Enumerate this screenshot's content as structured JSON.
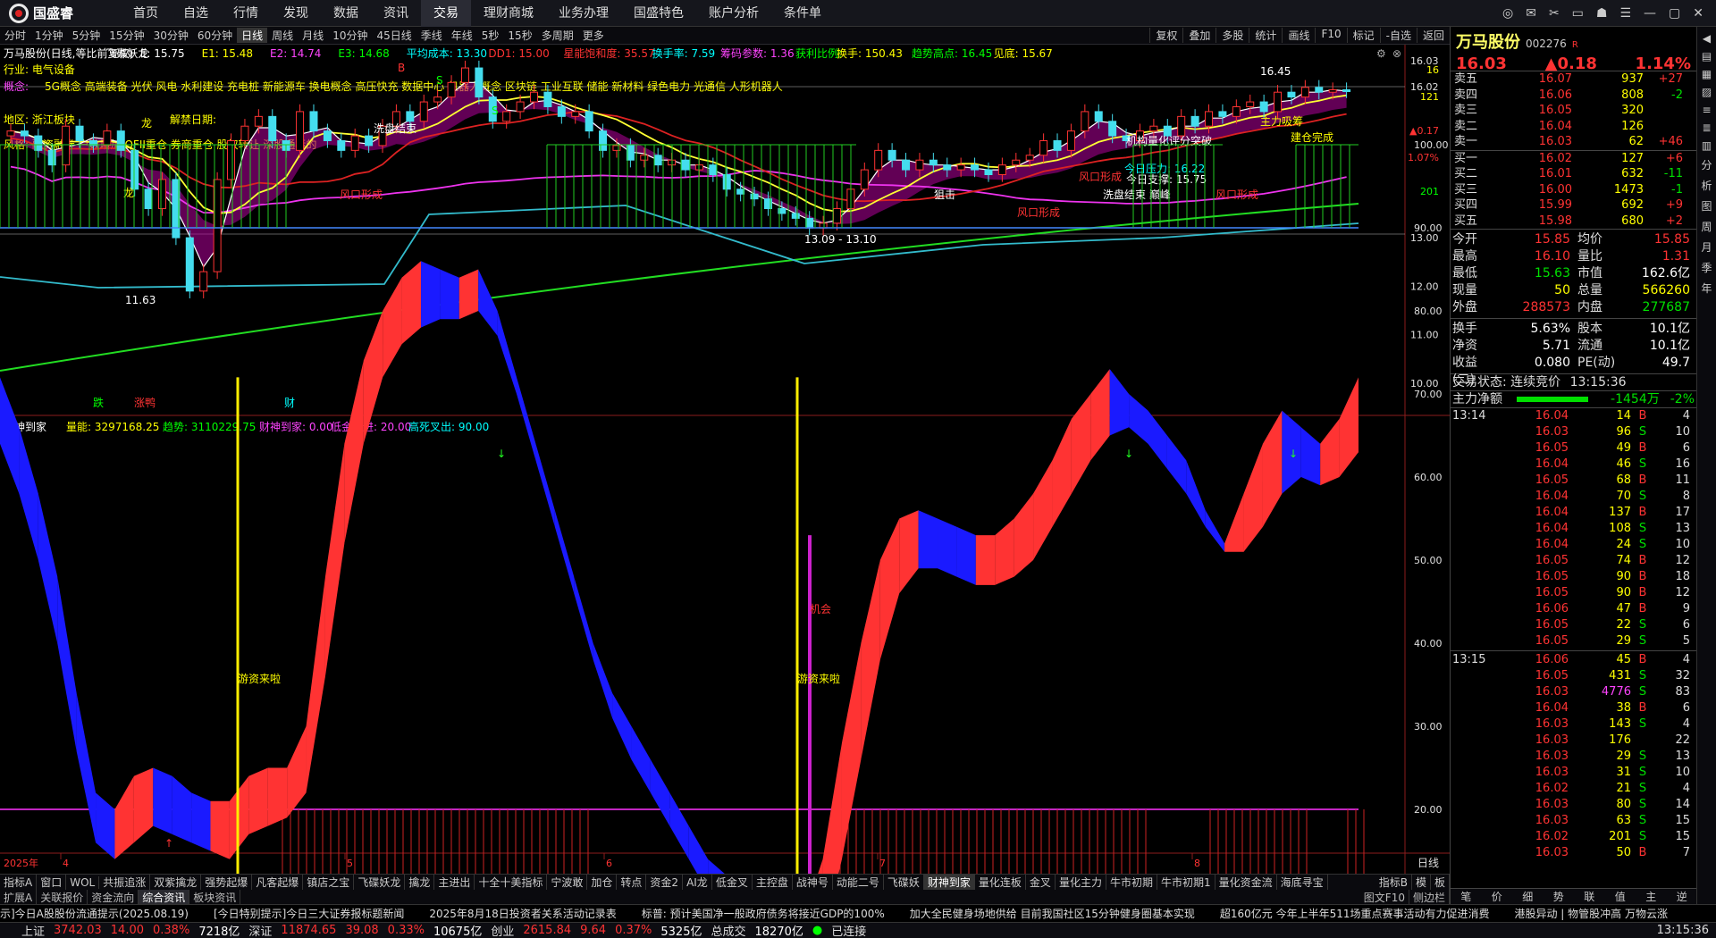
{
  "app": {
    "logo": "国盛睿",
    "menu": [
      "首页",
      "自选",
      "行情",
      "发现",
      "数据",
      "资讯",
      "交易",
      "理财商城",
      "业务办理",
      "国盛特色",
      "账户分析",
      "条件单"
    ],
    "active_menu": "交易"
  },
  "toolbar": {
    "items": [
      "分时",
      "1分钟",
      "5分钟",
      "15分钟",
      "30分钟",
      "60分钟",
      "日线",
      "周线",
      "月线",
      "10分钟",
      "45日线",
      "季线",
      "年线",
      "5秒",
      "15秒",
      "多周期",
      "更多"
    ],
    "active": "日线",
    "right": [
      "复权",
      "叠加",
      "多股",
      "统计",
      "画线",
      "F10",
      "标记",
      "-自选",
      "返回"
    ]
  },
  "chart": {
    "info_line": [
      {
        "t": "万马股份(日线,等比前复权)",
        "c": "#ffffff"
      },
      {
        "t": "飞碟妖龙",
        "c": "#ffffff"
      },
      {
        "t": "E: 15.75",
        "c": "#ffffff"
      },
      {
        "t": "E1: 15.48",
        "c": "#ffff00"
      },
      {
        "t": "E2: 14.74",
        "c": "#ff44ff"
      },
      {
        "t": "E3: 14.68",
        "c": "#00ff00"
      },
      {
        "t": "平均成本: 13.30",
        "c": "#00ffff"
      },
      {
        "t": "DD1: 15.00",
        "c": "#ff3333"
      },
      {
        "t": "星能饱和度: 35.57",
        "c": "#ff3333"
      },
      {
        "t": "换手率: 7.59",
        "c": "#00ffff"
      },
      {
        "t": "筹码参数: 1.36",
        "c": "#ff44ff"
      },
      {
        "t": "获利比例:",
        "c": "#00ff00"
      },
      {
        "t": "换手: 150.43",
        "c": "#ffff00"
      },
      {
        "t": "趋势高点: 16.45",
        "c": "#00ff00"
      },
      {
        "t": "见底: 15.67",
        "c": "#ffff00"
      }
    ],
    "industry": "行业: 电气设备",
    "concepts_label": "概念:",
    "concepts": "5G概念 高端装备 光伏 风电 水利建设 充电桩 新能源车 换电概念 高压快充 数据中心 机器人概念 区块链 工业互联 储能 新材料 绿色电力 光通信 人形机器人",
    "region": "地区: 浙江板块",
    "unlock": "解禁日期:",
    "style": "风格: 融资融券 户数增加 QFII重仓 券商重仓 股权转让 深股通标的",
    "y_labels": [
      "16.03",
      "16.02",
      "13.00",
      "12.00",
      "11.00",
      "10.00"
    ],
    "y_values": [
      16.03,
      16.02,
      13.0,
      12.0,
      11.0,
      10.0
    ],
    "right_small": [
      {
        "t": "16",
        "c": "#ffff00"
      },
      {
        "t": "121",
        "c": "#ffff00"
      },
      {
        "t": "▲0.17",
        "c": "#ff3333"
      },
      {
        "t": "1.07%",
        "c": "#ff3333"
      },
      {
        "t": "201",
        "c": "#00ff00"
      }
    ],
    "annot": [
      {
        "t": "洗盘结束",
        "c": "#ffffff"
      },
      {
        "t": "龙",
        "c": "#ffff00"
      },
      {
        "t": "龙",
        "c": "#ffff00"
      },
      {
        "t": "主力吸筹",
        "c": "#ffff00"
      },
      {
        "t": "建仓完成",
        "c": "#ffff00"
      },
      {
        "t": "机构量化评分突破",
        "c": "#ffffff"
      },
      {
        "t": "今日压力: 16.22",
        "c": "#00ffff"
      },
      {
        "t": "今日支撑: 15.75",
        "c": "#ffffff"
      },
      {
        "t": "洗盘结束 巅峰",
        "c": "#ffffff"
      },
      {
        "t": "狙击",
        "c": "#ffffff"
      },
      {
        "t": "风口形成",
        "c": "#ff3333"
      },
      {
        "t": "风口形成",
        "c": "#ff3333"
      },
      {
        "t": "风口形成",
        "c": "#ff3333"
      },
      {
        "t": "风口形成",
        "c": "#ff3333"
      },
      {
        "t": "16.45",
        "c": "#ffffff"
      },
      {
        "t": "11.63",
        "c": "#ffffff"
      },
      {
        "t": "13.09 - 13.10",
        "c": "#ffffff"
      },
      {
        "t": "跌",
        "c": "#00ff00"
      },
      {
        "t": "涨鸭",
        "c": "#ff3333"
      },
      {
        "t": "财",
        "c": "#00ffff"
      },
      {
        "t": "B",
        "c": "#ff3333"
      },
      {
        "t": "S",
        "c": "#00ff00"
      },
      {
        "t": "S",
        "c": "#00ff00"
      }
    ],
    "close": [
      15.2,
      15.1,
      14.8,
      14.5,
      15.3,
      15.0,
      14.9,
      15.2,
      14.8,
      14.0,
      13.6,
      14.2,
      13.0,
      11.9,
      12.3,
      14.2,
      15.0,
      15.3,
      15.5,
      15.0,
      14.8,
      15.6,
      15.2,
      15.0,
      14.8,
      15.1,
      14.9,
      15.3,
      15.6,
      15.4,
      15.8,
      15.9,
      16.2,
      16.5,
      15.9,
      15.4,
      15.6,
      15.8,
      16.0,
      15.7,
      15.5,
      15.6,
      15.2,
      14.8,
      14.9,
      14.6,
      14.7,
      14.5,
      14.6,
      14.4,
      14.5,
      14.3,
      14.0,
      13.9,
      13.8,
      13.6,
      13.5,
      13.4,
      13.2,
      13.3,
      13.6,
      14.0,
      14.4,
      14.8,
      14.6,
      14.4,
      14.6,
      14.5,
      14.4,
      14.5,
      14.4,
      14.3,
      14.5,
      14.6,
      14.7,
      15.0,
      14.8,
      15.2,
      15.6,
      15.4,
      15.1,
      15.0,
      15.2,
      15.3,
      15.1,
      15.5,
      15.3,
      15.6,
      15.5,
      15.7,
      15.8,
      15.6,
      16.0,
      15.9,
      16.1,
      16.0,
      16.05,
      16.03
    ]
  },
  "indicator": {
    "title": "财神到家",
    "vals": [
      {
        "t": "量能: 3297168.25",
        "c": "#ffff00"
      },
      {
        "t": "趋势: 3110229.75",
        "c": "#00ff00"
      },
      {
        "t": "财神到家: 0.00",
        "c": "#ff44ff"
      },
      {
        "t": "低金叉进: 20.00",
        "c": "#ff44ff"
      },
      {
        "t": "高死叉出: 90.00",
        "c": "#00ffff"
      }
    ],
    "y_labels": [
      "100.00",
      "90.00",
      "80.00",
      "70.00",
      "60.00",
      "50.00",
      "40.00",
      "30.00",
      "20.00"
    ],
    "y_values": [
      100,
      90,
      80,
      70,
      60,
      50,
      40,
      30,
      20
    ],
    "labels": [
      {
        "t": "游资来啦",
        "c": "#ffff00"
      },
      {
        "t": "游资来啦",
        "c": "#ffff00"
      },
      {
        "t": "机会",
        "c": "#ff3333"
      }
    ],
    "values": [
      72,
      66,
      58,
      48,
      34,
      22,
      20,
      24,
      25,
      24,
      22,
      21,
      21,
      24,
      25,
      25,
      30,
      48,
      64,
      74,
      80,
      84,
      86,
      85,
      84,
      85,
      80,
      72,
      64,
      56,
      48,
      40,
      34,
      30,
      26,
      22,
      18,
      14,
      12,
      10,
      9,
      8,
      7,
      14,
      28,
      40,
      50,
      55,
      56,
      55,
      54,
      53,
      53,
      55,
      58,
      62,
      67,
      70,
      73,
      70,
      68,
      65,
      62,
      56,
      52,
      58,
      64,
      68,
      66,
      64,
      67,
      72
    ],
    "signal": [
      70,
      64,
      56,
      46,
      33,
      22,
      20,
      22,
      24,
      23,
      22,
      21,
      20,
      23,
      24,
      25,
      28,
      42,
      58,
      70,
      78,
      82,
      84,
      85,
      85,
      86,
      83,
      76,
      68,
      60,
      52,
      44,
      37,
      32,
      28,
      24,
      20,
      16,
      13,
      11,
      10,
      9,
      8,
      10,
      20,
      32,
      44,
      52,
      55,
      55,
      54,
      53,
      53,
      54,
      56,
      60,
      64,
      68,
      71,
      72,
      70,
      67,
      64,
      60,
      57,
      57,
      60,
      64,
      66,
      65,
      66,
      69
    ]
  },
  "xaxis": {
    "year": "2025年",
    "labels": [
      "4",
      "5",
      "6",
      "7",
      "8"
    ],
    "period": "日线"
  },
  "tabs": [
    "指标A",
    "窗口",
    "WOL",
    "共振追涨",
    "双紫擒龙",
    "强势起爆",
    "凡客起爆",
    "镇店之宝",
    "飞碟妖龙",
    "擒龙",
    "主进出",
    "十全十美指标",
    "宁波敢",
    "加仓",
    "转点",
    "资金2",
    "AI龙",
    "低金叉",
    "主控盘",
    "战神号",
    "动能二号",
    "飞碟妖",
    "财神到家",
    "量化连板",
    "金叉",
    "量化主力",
    "牛市初期",
    "牛市初期1",
    "量化资金流",
    "海底寻宝"
  ],
  "tabs_active": "财神到家",
  "tabs_right": [
    "指标B",
    "模",
    "板"
  ],
  "tabs2": [
    "扩展A",
    "关联报价",
    "资金流向",
    "综合资讯",
    "板块资讯"
  ],
  "tabs2_active": "综合资讯",
  "tabs2_right": [
    "图文F10",
    "侧边栏"
  ],
  "quote": {
    "name": "万马股份",
    "code": "002276",
    "badge": "R",
    "price": "16.03",
    "change": "▲0.18",
    "pct": "1.14%",
    "asks": [
      [
        "卖五",
        "16.07",
        "937",
        "+27"
      ],
      [
        "卖四",
        "16.06",
        "808",
        "-2"
      ],
      [
        "卖三",
        "16.05",
        "320",
        ""
      ],
      [
        "卖二",
        "16.04",
        "126",
        ""
      ],
      [
        "卖一",
        "16.03",
        "62",
        "+46"
      ]
    ],
    "bids": [
      [
        "买一",
        "16.02",
        "127",
        "+6"
      ],
      [
        "买二",
        "16.01",
        "632",
        "-11"
      ],
      [
        "买三",
        "16.00",
        "1473",
        "-1"
      ],
      [
        "买四",
        "15.99",
        "692",
        "+9"
      ],
      [
        "买五",
        "15.98",
        "680",
        "+2"
      ]
    ],
    "stats": [
      [
        "今开",
        "15.85",
        "均价",
        "15.85"
      ],
      [
        "最高",
        "16.10",
        "量比",
        "1.31"
      ],
      [
        "最低",
        "15.63",
        "市值",
        "162.6亿"
      ],
      [
        "现量",
        "50",
        "总量",
        "566260"
      ],
      [
        "外盘",
        "288573",
        "内盘",
        "277687"
      ]
    ],
    "stats2": [
      [
        "换手",
        "5.63%",
        "股本",
        "10.1亿"
      ],
      [
        "净资",
        "5.71",
        "流通",
        "10.1亿"
      ],
      [
        "收益(二)",
        "0.080",
        "PE(动)",
        "49.7"
      ]
    ],
    "trade_state": "交易状态: 连续竞价",
    "trade_time": "13:15:36",
    "main_net_label": "主力净额",
    "main_net": "-1454万",
    "main_net_pct": "-2%",
    "ticks_a_time": "13:14",
    "ticks_b_time": "13:15",
    "ticks_a": [
      [
        "16.04",
        "14",
        "B",
        "4"
      ],
      [
        "16.03",
        "96",
        "S",
        "10"
      ],
      [
        "16.05",
        "49",
        "B",
        "6"
      ],
      [
        "16.04",
        "46",
        "S",
        "16"
      ],
      [
        "16.05",
        "68",
        "B",
        "11"
      ],
      [
        "16.04",
        "70",
        "S",
        "8"
      ],
      [
        "16.04",
        "137",
        "B",
        "17"
      ],
      [
        "16.04",
        "108",
        "S",
        "13"
      ],
      [
        "16.04",
        "24",
        "S",
        "10"
      ],
      [
        "16.05",
        "74",
        "B",
        "12"
      ],
      [
        "16.05",
        "90",
        "B",
        "18"
      ],
      [
        "16.05",
        "90",
        "B",
        "12"
      ],
      [
        "16.06",
        "47",
        "B",
        "9"
      ],
      [
        "16.05",
        "22",
        "S",
        "6"
      ],
      [
        "16.05",
        "29",
        "S",
        "5"
      ]
    ],
    "ticks_b": [
      [
        "16.06",
        "45",
        "B",
        "4"
      ],
      [
        "16.05",
        "431",
        "S",
        "32"
      ],
      [
        "16.03",
        "4776",
        "S",
        "83"
      ],
      [
        "16.04",
        "38",
        "B",
        "6"
      ],
      [
        "16.03",
        "143",
        "S",
        "4"
      ],
      [
        "16.03",
        "176",
        "",
        "22"
      ],
      [
        "16.03",
        "29",
        "S",
        "13"
      ],
      [
        "16.03",
        "31",
        "S",
        "10"
      ],
      [
        "16.02",
        "21",
        "S",
        "4"
      ],
      [
        "16.03",
        "80",
        "S",
        "14"
      ],
      [
        "16.03",
        "63",
        "S",
        "15"
      ],
      [
        "16.02",
        "201",
        "S",
        "15"
      ],
      [
        "16.03",
        "50",
        "B",
        "7"
      ]
    ],
    "bottom_tabs": [
      "笔",
      "价",
      "细",
      "势",
      "联",
      "值",
      "主",
      "逆"
    ]
  },
  "sidebar": [
    "分",
    "析",
    "图",
    "周",
    "月",
    "季",
    "年"
  ],
  "news": [
    "示]今日A股股份流通提示(2025.08.19)",
    "[今日特别提示]今日三大证券报标题新闻",
    "2025年8月18日投资者关系活动记录表",
    "标普: 预计美国净一般政府债务将接近GDP的100%",
    "加大全民健身场地供给 目前我国社区15分钟健身圈基本实现",
    "超160亿元 今年上半年511场重点赛事活动有力促进消费",
    "港股异动 | 物管股冲高 万物云涨"
  ],
  "status": {
    "sh_label": "上证",
    "sh": "3742.03",
    "sh_chg": "14.00",
    "sh_pct": "0.38%",
    "sh_amt": "7218亿",
    "sz_label": "深证",
    "sz": "11874.65",
    "sz_chg": "39.08",
    "sz_pct": "0.33%",
    "sz_amt": "10675亿",
    "cy_label": "创业",
    "cy": "2615.84",
    "cy_chg": "9.64",
    "cy_pct": "0.37%",
    "cy_amt": "5325亿",
    "total_label": "总成交",
    "total": "18270亿",
    "conn": "已连接",
    "clock": "13:15:36"
  }
}
